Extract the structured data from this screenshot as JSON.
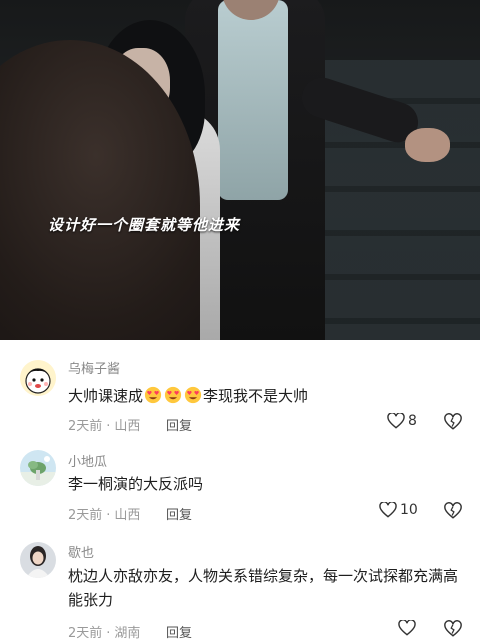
{
  "video": {
    "subtitle": "设计好一个圈套就等他进来"
  },
  "comments": [
    {
      "username": "乌梅子酱",
      "text_before": "大帅课速成",
      "emoji_count": 3,
      "text_after": "李现我不是大帅",
      "time": "2天前",
      "location": "山西",
      "reply_label": "回复",
      "likes": "8"
    },
    {
      "username": "小地瓜",
      "text": "李一桐演的大反派吗",
      "time": "2天前",
      "location": "山西",
      "reply_label": "回复",
      "likes": "10"
    },
    {
      "username": "歇也",
      "text": "枕边人亦敌亦友，人物关系错综复杂，每一次试探都充满高能张力",
      "time": "2天前",
      "location": "湖南",
      "reply_label": "回复",
      "likes": ""
    }
  ],
  "icons": {
    "like": "heart-outline-icon",
    "dislike": "broken-heart-icon",
    "emoji": "heart-eyes-face-icon"
  },
  "colors": {
    "username": "#8a8a8a",
    "meta": "#9a9a9a",
    "emoji_face": "#ffc83d",
    "emoji_heart": "#ff3b5c"
  }
}
